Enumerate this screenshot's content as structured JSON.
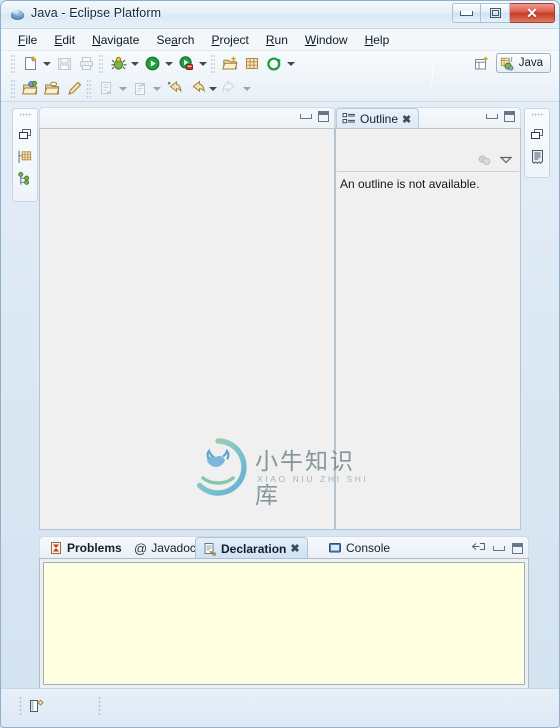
{
  "window": {
    "title": "Java - Eclipse Platform",
    "icon": "eclipse-icon",
    "buttons": {
      "minimize": "minimize",
      "maximize": "maximize",
      "close": "✕"
    }
  },
  "menubar": {
    "items": [
      {
        "label": "File",
        "mnemonic_index": 0
      },
      {
        "label": "Edit",
        "mnemonic_index": 0
      },
      {
        "label": "Navigate",
        "mnemonic_index": 0
      },
      {
        "label": "Search",
        "mnemonic_index": 2
      },
      {
        "label": "Project",
        "mnemonic_index": 0
      },
      {
        "label": "Run",
        "mnemonic_index": 0
      },
      {
        "label": "Window",
        "mnemonic_index": 0
      },
      {
        "label": "Help",
        "mnemonic_index": 0
      }
    ]
  },
  "toolbar": {
    "row1": [
      {
        "name": "new-wizard-button",
        "icon": "new-document-icon",
        "enabled": true,
        "dropdown": true
      },
      {
        "name": "save-button",
        "icon": "save-disk-icon",
        "enabled": false,
        "dropdown": false
      },
      {
        "name": "print-button",
        "icon": "printer-icon",
        "enabled": false,
        "dropdown": false
      },
      {
        "name": "debug-button",
        "icon": "debug-bug-icon",
        "enabled": true,
        "dropdown": true
      },
      {
        "name": "run-button",
        "icon": "run-play-icon",
        "enabled": true,
        "dropdown": true
      },
      {
        "name": "external-tools-button",
        "icon": "external-tools-icon",
        "enabled": true,
        "dropdown": true
      },
      {
        "name": "new-java-project-button",
        "icon": "new-java-project-icon",
        "enabled": true,
        "dropdown": false
      },
      {
        "name": "new-package-button",
        "icon": "new-package-icon",
        "enabled": true,
        "dropdown": false
      },
      {
        "name": "new-class-button",
        "icon": "new-class-icon",
        "enabled": true,
        "dropdown": true
      }
    ],
    "row2": [
      {
        "name": "open-type-button",
        "icon": "open-type-icon",
        "enabled": true,
        "dropdown": false
      },
      {
        "name": "open-resource-button",
        "icon": "open-folder-icon",
        "enabled": true,
        "dropdown": false
      },
      {
        "name": "search-button",
        "icon": "search-pencil-icon",
        "enabled": true,
        "dropdown": false
      },
      {
        "name": "next-annotation-button",
        "icon": "next-annotation-icon",
        "enabled": false,
        "dropdown": true
      },
      {
        "name": "previous-annotation-button",
        "icon": "previous-annotation-icon",
        "enabled": false,
        "dropdown": true
      },
      {
        "name": "last-edit-location-button",
        "icon": "last-edit-location-icon",
        "enabled": true,
        "dropdown": false
      },
      {
        "name": "back-button",
        "icon": "back-arrow-icon",
        "enabled": true,
        "dropdown": true
      },
      {
        "name": "forward-button",
        "icon": "forward-arrow-icon",
        "enabled": false,
        "dropdown": true
      }
    ],
    "perspective": {
      "open_perspective_icon": "open-perspective-icon",
      "active_label": "Java",
      "active_icon": "java-perspective-icon"
    }
  },
  "left_fast_view": {
    "items": [
      {
        "name": "restore-left-button",
        "icon": "restore-icon"
      },
      {
        "name": "package-explorer-shortcut",
        "icon": "package-explorer-icon"
      },
      {
        "name": "hierarchy-shortcut",
        "icon": "hierarchy-icon"
      }
    ]
  },
  "right_fast_view": {
    "items": [
      {
        "name": "restore-right-button",
        "icon": "restore-icon"
      },
      {
        "name": "outline-shortcut",
        "icon": "outline-document-icon"
      }
    ]
  },
  "editor": {
    "controls": {
      "minimize": "minimize",
      "maximize": "maximize"
    },
    "content": ""
  },
  "outline": {
    "tab_label": "Outline",
    "tab_icon": "outline-icon",
    "close_glyph": "✖",
    "toolbar": [
      {
        "name": "hide-fields-button",
        "icon": "hide-fields-icon",
        "enabled": false
      },
      {
        "name": "view-menu-button",
        "icon": "view-menu-chevron-icon",
        "enabled": true
      }
    ],
    "message": "An outline is not available.",
    "controls": {
      "minimize": "minimize",
      "maximize": "maximize"
    }
  },
  "bottom_panel": {
    "tabs": [
      {
        "label": "Problems",
        "icon": "problems-icon",
        "active": false,
        "bold": true,
        "closable": false
      },
      {
        "label": "Javadoc",
        "icon": "javadoc-at-icon",
        "active": false,
        "bold": false,
        "closable": false
      },
      {
        "label": "Declaration",
        "icon": "declaration-icon",
        "active": true,
        "bold": true,
        "closable": true
      },
      {
        "label": "Console",
        "icon": "console-icon",
        "active": false,
        "bold": false,
        "closable": false
      }
    ],
    "close_glyph": "✖",
    "controls": [
      {
        "name": "restore-button",
        "icon": "restore-view-icon"
      },
      {
        "name": "minimize-button",
        "icon": "minimize-icon"
      },
      {
        "name": "maximize-button",
        "icon": "maximize-icon"
      }
    ],
    "content": "",
    "content_bg": "#FFFFE1"
  },
  "statusbar": {
    "icon": "writable-insert-icon",
    "fields": [
      "",
      ""
    ]
  },
  "watermark": {
    "chinese": "小牛知识库",
    "pinyin": "XIAO NIU ZHI SHI KU",
    "logo_icon": "ox-circle-logo"
  },
  "colors": {
    "title_accent": "#1c3a52",
    "close_red": "#c63a26",
    "editor_bg": "#F0F0F0",
    "declaration_bg": "#FFFFE1",
    "active_tab": "#D4E5F5"
  }
}
